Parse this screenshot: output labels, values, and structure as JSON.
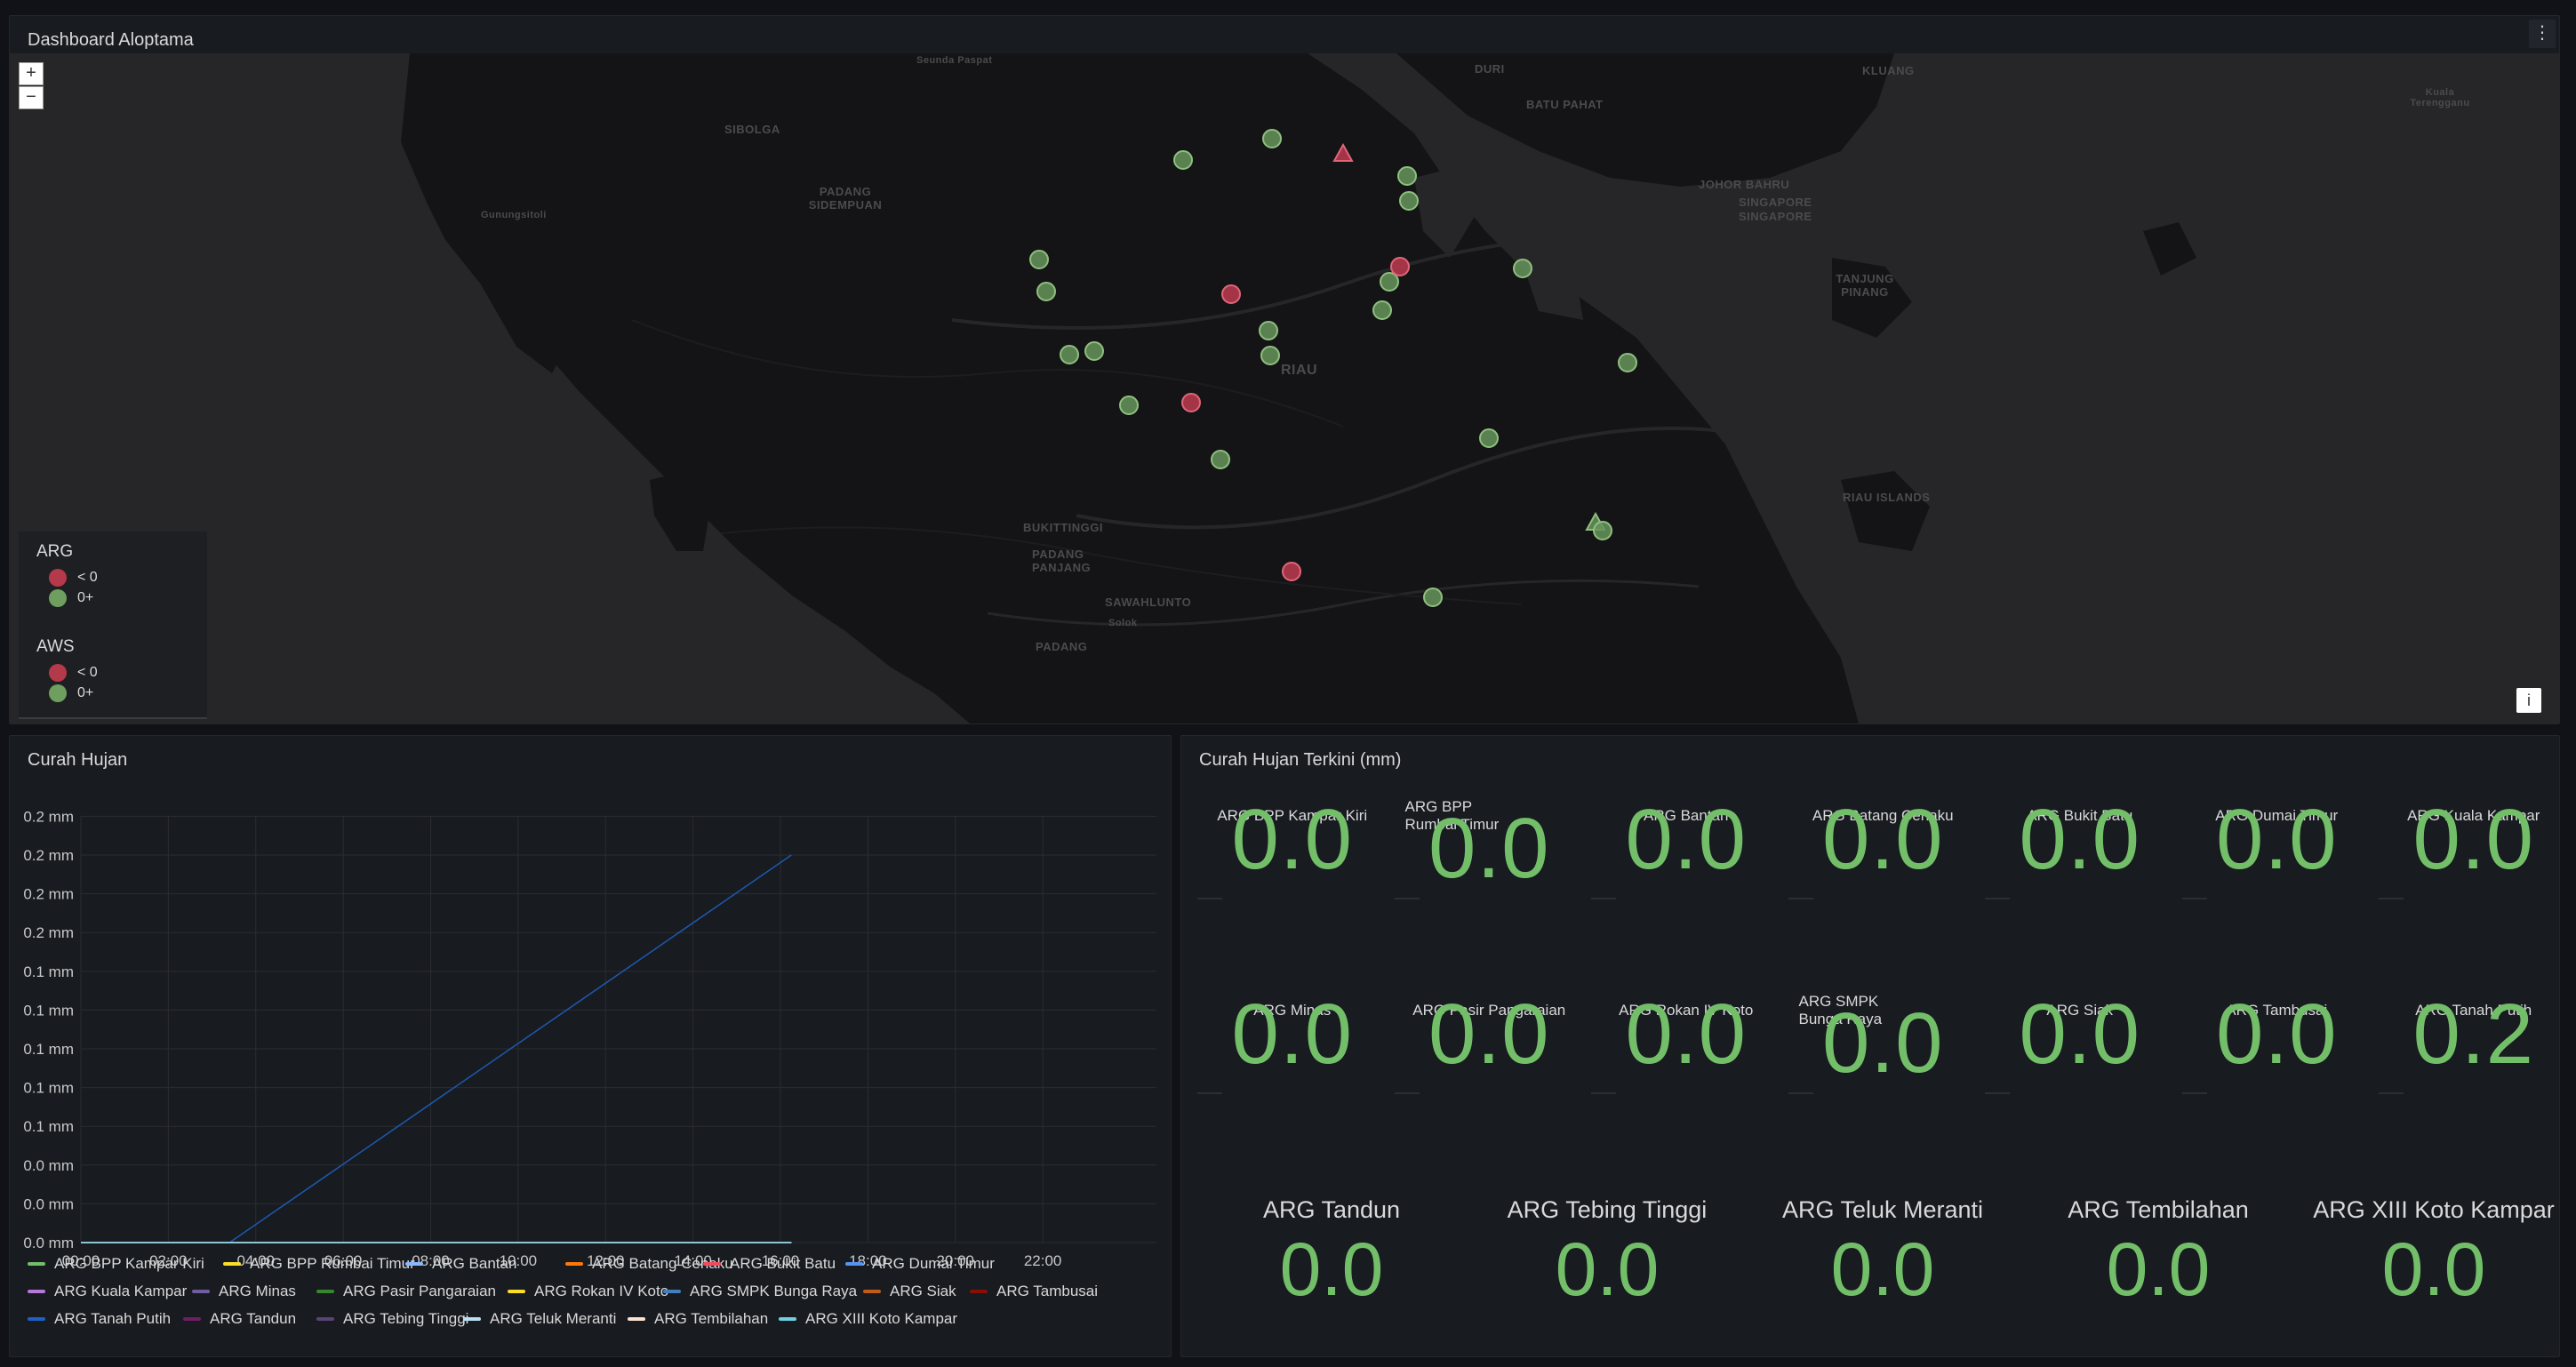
{
  "map_panel": {
    "title": "Dashboard Aloptama",
    "menu_icon": "⋮",
    "zoom_in": "+",
    "zoom_out": "−",
    "info": "i",
    "labels": [
      {
        "text": "Seunda Paspat"
      },
      {
        "text": "SIBOLGA"
      },
      {
        "text": "Gunungsitoli"
      },
      {
        "text": "PADANG SIDEMPUAN"
      },
      {
        "text": "DURI"
      },
      {
        "text": "BATU PAHAT"
      },
      {
        "text": "KLUANG"
      },
      {
        "text": "JOHOR BAHRU"
      },
      {
        "text": "SINGAPORE"
      },
      {
        "text": "SINGAPORE"
      },
      {
        "text": "RIAU"
      },
      {
        "text": "TANJUNG PINANG"
      },
      {
        "text": "BUKITTINGGI"
      },
      {
        "text": "PADANG PANJANG"
      },
      {
        "text": "SAWAHLUNTO"
      },
      {
        "text": "Solok"
      },
      {
        "text": "PADANG"
      },
      {
        "text": "RIAU ISLANDS"
      },
      {
        "text": "Kuala Terengganu"
      }
    ],
    "legend": {
      "arg": {
        "title": "ARG",
        "items": [
          {
            "label": "< 0",
            "color": "#b4394b"
          },
          {
            "label": "0+",
            "color": "#6e9f5f"
          }
        ]
      },
      "aws": {
        "title": "AWS",
        "items": [
          {
            "label": "< 0",
            "color": "#b4394b"
          },
          {
            "label": "0+",
            "color": "#6e9f5f"
          }
        ]
      }
    },
    "markers": [
      {
        "status": "ok"
      },
      {
        "status": "ok"
      },
      {
        "status": "alert-aws"
      },
      {
        "status": "ok"
      },
      {
        "status": "ok"
      },
      {
        "status": "ok"
      },
      {
        "status": "ok"
      },
      {
        "status": "alert"
      },
      {
        "status": "ok"
      },
      {
        "status": "alert"
      },
      {
        "status": "ok"
      },
      {
        "status": "ok"
      },
      {
        "status": "ok"
      },
      {
        "status": "ok"
      },
      {
        "status": "ok"
      },
      {
        "status": "ok"
      },
      {
        "status": "alert"
      },
      {
        "status": "ok"
      },
      {
        "status": "ok"
      },
      {
        "status": "ok"
      },
      {
        "status": "ok"
      },
      {
        "status": "ok-aws"
      },
      {
        "status": "ok"
      },
      {
        "status": "alert"
      },
      {
        "status": "ok"
      }
    ]
  },
  "chart_panel": {
    "title": "Curah Hujan",
    "chart_data": {
      "type": "line",
      "xlabel": "",
      "ylabel": "",
      "x_ticks": [
        "00:00",
        "02:00",
        "04:00",
        "06:00",
        "08:00",
        "10:00",
        "12:00",
        "14:00",
        "16:00",
        "18:00",
        "20:00",
        "22:00"
      ],
      "y_ticks": [
        "0.2 mm",
        "0.2 mm",
        "0.2 mm",
        "0.2 mm",
        "0.1 mm",
        "0.1 mm",
        "0.1 mm",
        "0.1 mm",
        "0.1 mm",
        "0.0 mm",
        "0.0 mm",
        "0.0 mm"
      ],
      "ylim": [
        0,
        0.22
      ],
      "xlim_hours": [
        0,
        24.6
      ],
      "grid": true,
      "legend_position": "bottom",
      "series": [
        {
          "name": "ARG BPP Kampar Kiri",
          "color": "#73bf69",
          "points": [
            [
              0,
              0
            ],
            [
              16.25,
              0
            ]
          ]
        },
        {
          "name": "ARG BPP Rumbai Timur",
          "color": "#fade2a",
          "points": [
            [
              0,
              0
            ],
            [
              16.25,
              0
            ]
          ]
        },
        {
          "name": "ARG Bantan",
          "color": "#8ab8ff",
          "points": [
            [
              0,
              0
            ],
            [
              16.25,
              0
            ]
          ]
        },
        {
          "name": "ARG Batang Cenaku",
          "color": "#ff780a",
          "points": [
            [
              0,
              0
            ],
            [
              16.25,
              0
            ]
          ]
        },
        {
          "name": "ARG Bukit Batu",
          "color": "#f2495c",
          "points": [
            [
              0,
              0
            ],
            [
              16.25,
              0
            ]
          ]
        },
        {
          "name": "ARG Dumai Timur",
          "color": "#5794f2",
          "points": [
            [
              0,
              0
            ],
            [
              16.25,
              0
            ]
          ]
        },
        {
          "name": "ARG Kuala Kampar",
          "color": "#b877d9",
          "points": [
            [
              0,
              0
            ],
            [
              16.25,
              0
            ]
          ]
        },
        {
          "name": "ARG Minas",
          "color": "#705da0",
          "points": [
            [
              0,
              0
            ],
            [
              16.25,
              0
            ]
          ]
        },
        {
          "name": "ARG Pasir Pangaraian",
          "color": "#37872d",
          "points": [
            [
              0,
              0
            ],
            [
              16.25,
              0
            ]
          ]
        },
        {
          "name": "ARG Rokan IV Koto",
          "color": "#fade2a",
          "points": [
            [
              0,
              0
            ],
            [
              16.25,
              0
            ]
          ]
        },
        {
          "name": "ARG SMPK Bunga Raya",
          "color": "#447ebc",
          "points": [
            [
              0,
              0
            ],
            [
              16.25,
              0
            ]
          ]
        },
        {
          "name": "ARG Siak",
          "color": "#c15c17",
          "points": [
            [
              0,
              0
            ],
            [
              16.25,
              0
            ]
          ]
        },
        {
          "name": "ARG Tambusai",
          "color": "#890f02",
          "points": [
            [
              0,
              0
            ],
            [
              16.25,
              0
            ]
          ]
        },
        {
          "name": "ARG Tanah Putih",
          "color": "#1f60c4",
          "points": [
            [
              0,
              0
            ],
            [
              3.4,
              0
            ],
            [
              16.25,
              0.2
            ]
          ]
        },
        {
          "name": "ARG Tandun",
          "color": "#6d1f62",
          "points": [
            [
              0,
              0
            ],
            [
              16.25,
              0
            ]
          ]
        },
        {
          "name": "ARG Tebing Tinggi",
          "color": "#584477",
          "points": [
            [
              0,
              0
            ],
            [
              16.25,
              0
            ]
          ]
        },
        {
          "name": "ARG Teluk Meranti",
          "color": "#badff4",
          "points": [
            [
              0,
              0
            ],
            [
              16.25,
              0
            ]
          ]
        },
        {
          "name": "ARG Tembilahan",
          "color": "#f9e2d2",
          "points": [
            [
              0,
              0
            ],
            [
              16.25,
              0
            ]
          ]
        },
        {
          "name": "ARG XIII Koto Kampar",
          "color": "#6ed0e0",
          "points": [
            [
              0,
              0
            ],
            [
              16.25,
              0
            ]
          ]
        }
      ]
    }
  },
  "stat_panel": {
    "title": "Curah Hujan Terkini (mm)",
    "row1": [
      {
        "name": "ARG BPP Kampar Kiri",
        "value": "0.0"
      },
      {
        "name": "ARG BPP Rumbai Timur",
        "value": "0.0"
      },
      {
        "name": "ARG Bantan",
        "value": "0.0"
      },
      {
        "name": "ARG Batang Cenaku",
        "value": "0.0"
      },
      {
        "name": "ARG Bukit Batu",
        "value": "0.0"
      },
      {
        "name": "ARG Dumai Timur",
        "value": "0.0"
      },
      {
        "name": "ARG Kuala Kampar",
        "value": "0.0"
      }
    ],
    "row2": [
      {
        "name": "ARG Minas",
        "value": "0.0"
      },
      {
        "name": "ARG Pasir Pangaraian",
        "value": "0.0"
      },
      {
        "name": "ARG Rokan IV Koto",
        "value": "0.0"
      },
      {
        "name": "ARG SMPK Bunga Raya",
        "value": "0.0"
      },
      {
        "name": "ARG Siak",
        "value": "0.0"
      },
      {
        "name": "ARG Tambusai",
        "value": "0.0"
      },
      {
        "name": "ARG Tanah Putih",
        "value": "0.2"
      }
    ],
    "row3": [
      {
        "name": "ARG Tandun",
        "value": "0.0"
      },
      {
        "name": "ARG Tebing Tinggi",
        "value": "0.0"
      },
      {
        "name": "ARG Teluk Meranti",
        "value": "0.0"
      },
      {
        "name": "ARG Tembilahan",
        "value": "0.0"
      },
      {
        "name": "ARG XIII Koto Kampar",
        "value": "0.0"
      }
    ]
  }
}
